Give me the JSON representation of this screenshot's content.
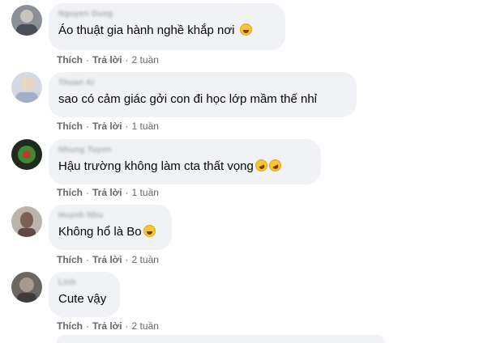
{
  "comments": [
    {
      "author": "Nguyen Dung",
      "text": "Áo thuật gia hành nghề khắp nơi",
      "emoji": [
        "grinning-emoji"
      ],
      "like_label": "Thích",
      "reply_label": "Trả lời",
      "time": "2 tuần",
      "avatar_color": "#7a7f87"
    },
    {
      "author": "Thuan Ai",
      "text": "sao có cảm giác gởi con đi học lớp mầm thế nhỉ",
      "emoji": [],
      "like_label": "Thích",
      "reply_label": "Trả lời",
      "time": "1 tuần",
      "avatar_color": "#b7c4d6"
    },
    {
      "author": "Nhung Tuyen",
      "text": "Hậu trường không làm cta thất vọng",
      "emoji": [
        "rofl-emoji",
        "rofl-emoji"
      ],
      "like_label": "Thích",
      "reply_label": "Trả lời",
      "time": "1 tuần",
      "avatar_color": "#2f5b2a"
    },
    {
      "author": "Huynh Nhu",
      "text": "Không hổ là Bo",
      "emoji": [
        "laughing-emoji"
      ],
      "like_label": "Thích",
      "reply_label": "Trả lời",
      "time": "2 tuần",
      "avatar_color": "#8c7d76"
    },
    {
      "author": "Linh",
      "text": "Cute vậy",
      "emoji": [],
      "like_label": "Thích",
      "reply_label": "Trả lời",
      "time": "2 tuần",
      "avatar_color": "#56534f"
    }
  ]
}
